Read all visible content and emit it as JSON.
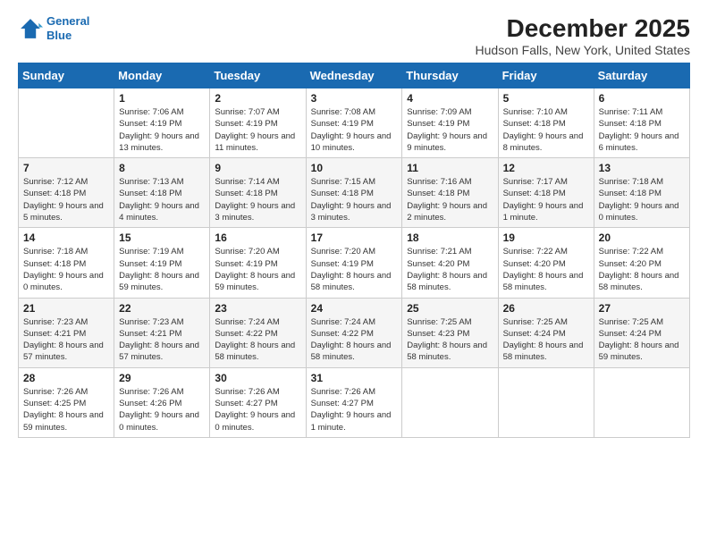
{
  "logo": {
    "line1": "General",
    "line2": "Blue"
  },
  "title": "December 2025",
  "subtitle": "Hudson Falls, New York, United States",
  "header": {
    "days": [
      "Sunday",
      "Monday",
      "Tuesday",
      "Wednesday",
      "Thursday",
      "Friday",
      "Saturday"
    ]
  },
  "weeks": [
    {
      "cells": [
        {
          "day": "",
          "sunrise": "",
          "sunset": "",
          "daylight": ""
        },
        {
          "day": "1",
          "sunrise": "Sunrise: 7:06 AM",
          "sunset": "Sunset: 4:19 PM",
          "daylight": "Daylight: 9 hours and 13 minutes."
        },
        {
          "day": "2",
          "sunrise": "Sunrise: 7:07 AM",
          "sunset": "Sunset: 4:19 PM",
          "daylight": "Daylight: 9 hours and 11 minutes."
        },
        {
          "day": "3",
          "sunrise": "Sunrise: 7:08 AM",
          "sunset": "Sunset: 4:19 PM",
          "daylight": "Daylight: 9 hours and 10 minutes."
        },
        {
          "day": "4",
          "sunrise": "Sunrise: 7:09 AM",
          "sunset": "Sunset: 4:19 PM",
          "daylight": "Daylight: 9 hours and 9 minutes."
        },
        {
          "day": "5",
          "sunrise": "Sunrise: 7:10 AM",
          "sunset": "Sunset: 4:18 PM",
          "daylight": "Daylight: 9 hours and 8 minutes."
        },
        {
          "day": "6",
          "sunrise": "Sunrise: 7:11 AM",
          "sunset": "Sunset: 4:18 PM",
          "daylight": "Daylight: 9 hours and 6 minutes."
        }
      ]
    },
    {
      "cells": [
        {
          "day": "7",
          "sunrise": "Sunrise: 7:12 AM",
          "sunset": "Sunset: 4:18 PM",
          "daylight": "Daylight: 9 hours and 5 minutes."
        },
        {
          "day": "8",
          "sunrise": "Sunrise: 7:13 AM",
          "sunset": "Sunset: 4:18 PM",
          "daylight": "Daylight: 9 hours and 4 minutes."
        },
        {
          "day": "9",
          "sunrise": "Sunrise: 7:14 AM",
          "sunset": "Sunset: 4:18 PM",
          "daylight": "Daylight: 9 hours and 3 minutes."
        },
        {
          "day": "10",
          "sunrise": "Sunrise: 7:15 AM",
          "sunset": "Sunset: 4:18 PM",
          "daylight": "Daylight: 9 hours and 3 minutes."
        },
        {
          "day": "11",
          "sunrise": "Sunrise: 7:16 AM",
          "sunset": "Sunset: 4:18 PM",
          "daylight": "Daylight: 9 hours and 2 minutes."
        },
        {
          "day": "12",
          "sunrise": "Sunrise: 7:17 AM",
          "sunset": "Sunset: 4:18 PM",
          "daylight": "Daylight: 9 hours and 1 minute."
        },
        {
          "day": "13",
          "sunrise": "Sunrise: 7:18 AM",
          "sunset": "Sunset: 4:18 PM",
          "daylight": "Daylight: 9 hours and 0 minutes."
        }
      ]
    },
    {
      "cells": [
        {
          "day": "14",
          "sunrise": "Sunrise: 7:18 AM",
          "sunset": "Sunset: 4:18 PM",
          "daylight": "Daylight: 9 hours and 0 minutes."
        },
        {
          "day": "15",
          "sunrise": "Sunrise: 7:19 AM",
          "sunset": "Sunset: 4:19 PM",
          "daylight": "Daylight: 8 hours and 59 minutes."
        },
        {
          "day": "16",
          "sunrise": "Sunrise: 7:20 AM",
          "sunset": "Sunset: 4:19 PM",
          "daylight": "Daylight: 8 hours and 59 minutes."
        },
        {
          "day": "17",
          "sunrise": "Sunrise: 7:20 AM",
          "sunset": "Sunset: 4:19 PM",
          "daylight": "Daylight: 8 hours and 58 minutes."
        },
        {
          "day": "18",
          "sunrise": "Sunrise: 7:21 AM",
          "sunset": "Sunset: 4:20 PM",
          "daylight": "Daylight: 8 hours and 58 minutes."
        },
        {
          "day": "19",
          "sunrise": "Sunrise: 7:22 AM",
          "sunset": "Sunset: 4:20 PM",
          "daylight": "Daylight: 8 hours and 58 minutes."
        },
        {
          "day": "20",
          "sunrise": "Sunrise: 7:22 AM",
          "sunset": "Sunset: 4:20 PM",
          "daylight": "Daylight: 8 hours and 58 minutes."
        }
      ]
    },
    {
      "cells": [
        {
          "day": "21",
          "sunrise": "Sunrise: 7:23 AM",
          "sunset": "Sunset: 4:21 PM",
          "daylight": "Daylight: 8 hours and 57 minutes."
        },
        {
          "day": "22",
          "sunrise": "Sunrise: 7:23 AM",
          "sunset": "Sunset: 4:21 PM",
          "daylight": "Daylight: 8 hours and 57 minutes."
        },
        {
          "day": "23",
          "sunrise": "Sunrise: 7:24 AM",
          "sunset": "Sunset: 4:22 PM",
          "daylight": "Daylight: 8 hours and 58 minutes."
        },
        {
          "day": "24",
          "sunrise": "Sunrise: 7:24 AM",
          "sunset": "Sunset: 4:22 PM",
          "daylight": "Daylight: 8 hours and 58 minutes."
        },
        {
          "day": "25",
          "sunrise": "Sunrise: 7:25 AM",
          "sunset": "Sunset: 4:23 PM",
          "daylight": "Daylight: 8 hours and 58 minutes."
        },
        {
          "day": "26",
          "sunrise": "Sunrise: 7:25 AM",
          "sunset": "Sunset: 4:24 PM",
          "daylight": "Daylight: 8 hours and 58 minutes."
        },
        {
          "day": "27",
          "sunrise": "Sunrise: 7:25 AM",
          "sunset": "Sunset: 4:24 PM",
          "daylight": "Daylight: 8 hours and 59 minutes."
        }
      ]
    },
    {
      "cells": [
        {
          "day": "28",
          "sunrise": "Sunrise: 7:26 AM",
          "sunset": "Sunset: 4:25 PM",
          "daylight": "Daylight: 8 hours and 59 minutes."
        },
        {
          "day": "29",
          "sunrise": "Sunrise: 7:26 AM",
          "sunset": "Sunset: 4:26 PM",
          "daylight": "Daylight: 9 hours and 0 minutes."
        },
        {
          "day": "30",
          "sunrise": "Sunrise: 7:26 AM",
          "sunset": "Sunset: 4:27 PM",
          "daylight": "Daylight: 9 hours and 0 minutes."
        },
        {
          "day": "31",
          "sunrise": "Sunrise: 7:26 AM",
          "sunset": "Sunset: 4:27 PM",
          "daylight": "Daylight: 9 hours and 1 minute."
        },
        {
          "day": "",
          "sunrise": "",
          "sunset": "",
          "daylight": ""
        },
        {
          "day": "",
          "sunrise": "",
          "sunset": "",
          "daylight": ""
        },
        {
          "day": "",
          "sunrise": "",
          "sunset": "",
          "daylight": ""
        }
      ]
    }
  ]
}
